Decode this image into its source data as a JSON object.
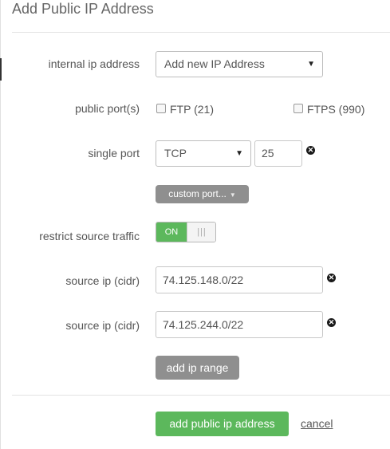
{
  "dialog": {
    "title": "Add Public IP Address"
  },
  "form": {
    "internal_ip": {
      "label": "internal ip address",
      "selected": "Add new IP Address"
    },
    "public_ports": {
      "label": "public port(s)",
      "options": [
        {
          "label": "FTP (21)",
          "checked": false
        },
        {
          "label": "FTPS (990)",
          "checked": false
        }
      ]
    },
    "single_port": {
      "label": "single port",
      "protocol": "TCP",
      "port": "25"
    },
    "custom_port": {
      "label": "custom port..."
    },
    "restrict_source": {
      "label": "restrict source traffic",
      "state": "ON",
      "handle_glyph": "|||"
    },
    "sources": [
      {
        "label": "source ip (cidr)",
        "value": "74.125.148.0/22"
      },
      {
        "label": "source ip (cidr)",
        "value": "74.125.244.0/22"
      }
    ],
    "add_range": {
      "label": "add ip range"
    }
  },
  "footer": {
    "submit_label": "add public ip address",
    "cancel_label": "cancel"
  },
  "colors": {
    "primary": "#5cb85c",
    "neutral_button": "#8f8f8f"
  },
  "icons": {
    "remove": "remove-circle-icon",
    "dropdown": "caret-down-icon"
  }
}
